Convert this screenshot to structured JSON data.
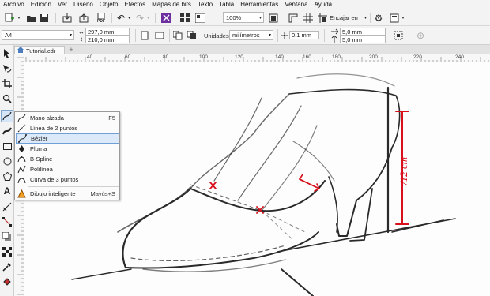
{
  "menubar": {
    "items": [
      "Archivo",
      "Edición",
      "Ver",
      "Diseño",
      "Objeto",
      "Efectos",
      "Mapas de bits",
      "Texto",
      "Tabla",
      "Herramientas",
      "Ventana",
      "Ayuda"
    ]
  },
  "standard_toolbar": {
    "zoom_value": "100%",
    "snap_label": "Encajar en",
    "pdf_label": "PDF"
  },
  "property_bar": {
    "page_size": "A4",
    "width": "297,0 mm",
    "height": "210,0 mm",
    "units_label": "Unidades:",
    "units_value": "milímetros",
    "nudge": "0,1 mm",
    "dup_x": "5,0 mm",
    "dup_y": "5,0 mm"
  },
  "document_tab": {
    "name": "Tutorial.cdr",
    "add_label": "+"
  },
  "rulers": {
    "horizontal_ticks": [
      "40",
      "60",
      "80",
      "100",
      "120",
      "140",
      "160",
      "180",
      "200",
      "220",
      "240"
    ],
    "vertical_ticks": [
      "20",
      "40",
      "60",
      "80",
      "100",
      "120",
      "140",
      "160",
      "180",
      "200",
      "220",
      "240",
      "260"
    ]
  },
  "flyout": {
    "items": [
      {
        "label": "Mano alzada",
        "shortcut": "F5",
        "icon": "freehand-icon"
      },
      {
        "label": "Línea de 2 puntos",
        "shortcut": "",
        "icon": "two-point-line-icon"
      },
      {
        "label": "Bézier",
        "shortcut": "",
        "icon": "bezier-icon",
        "selected": true
      },
      {
        "label": "Pluma",
        "shortcut": "",
        "icon": "pen-icon"
      },
      {
        "label": "B-Spline",
        "shortcut": "",
        "icon": "b-spline-icon"
      },
      {
        "label": "Polilínea",
        "shortcut": "",
        "icon": "polyline-icon"
      },
      {
        "label": "Curva de 3 puntos",
        "shortcut": "",
        "icon": "three-point-curve-icon"
      },
      {
        "label": "Dibujo inteligente",
        "shortcut": "Mayús+S",
        "icon": "smart-drawing-icon"
      }
    ]
  },
  "canvas": {
    "annotation": "/12 cm",
    "annotation_color": "#d8101c"
  },
  "colors": {
    "chrome": "#f3f3f3",
    "selection": "#dce9f8",
    "accent_purple": "#6b2fa0",
    "annotation_red": "#d8101c"
  }
}
